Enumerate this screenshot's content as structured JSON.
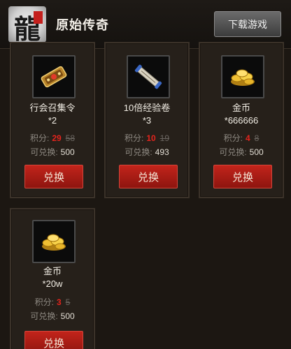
{
  "header": {
    "logo_glyph": "龍",
    "title": "原始传奇",
    "download_label": "下载游戏"
  },
  "items": [
    {
      "name": "行会召集令",
      "qty": "*2",
      "price_label": "积分:",
      "price": "29",
      "original_price": "58",
      "stock_label": "可兑换:",
      "stock": "500",
      "button": "兑换",
      "icon": "guild-token-icon"
    },
    {
      "name": "10倍经验卷",
      "qty": "*3",
      "price_label": "积分:",
      "price": "10",
      "original_price": "19",
      "stock_label": "可兑换:",
      "stock": "493",
      "button": "兑换",
      "icon": "exp-scroll-icon"
    },
    {
      "name": "金币",
      "qty": "*666666",
      "price_label": "积分:",
      "price": "4",
      "original_price": "8",
      "stock_label": "可兑换:",
      "stock": "500",
      "button": "兑换",
      "icon": "gold-coins-icon"
    },
    {
      "name": "金币",
      "qty": "*20w",
      "price_label": "积分:",
      "price": "3",
      "original_price": "5",
      "stock_label": "可兑换:",
      "stock": "500",
      "button": "兑换",
      "icon": "gold-coins-icon"
    }
  ],
  "colors": {
    "background": "#1c1712",
    "accent_red": "#e3241d",
    "button_red": "#b11e16"
  }
}
